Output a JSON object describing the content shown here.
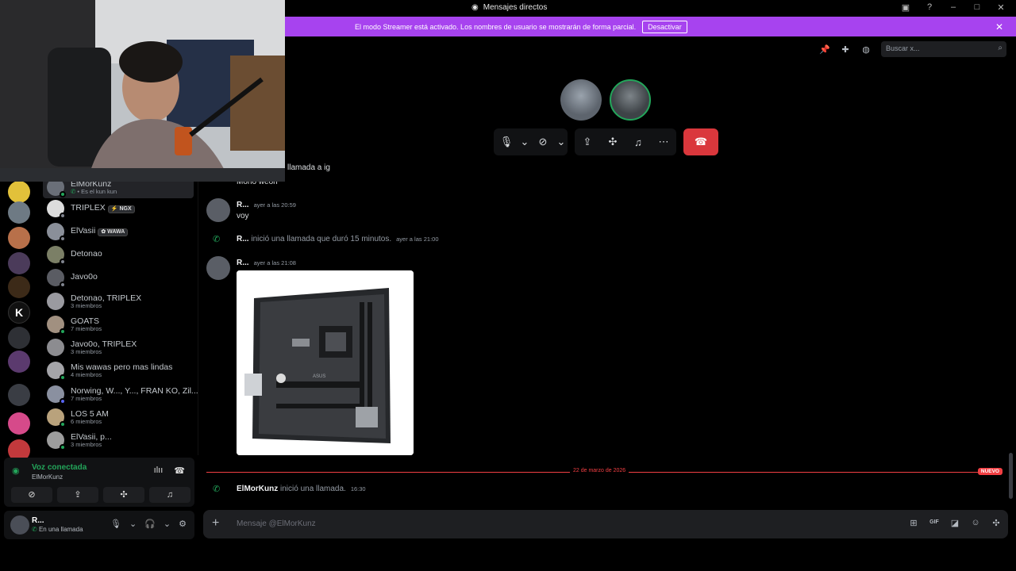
{
  "titlebar": {
    "title": "Mensajes directos"
  },
  "streamer": {
    "message": "El modo Streamer está activado. Los nombres de usuario se mostrarán de forma parcial.",
    "button": "Desactivar"
  },
  "dms": [
    {
      "name": "ElMorKunz",
      "sub": "Es el kun kun",
      "status": "on",
      "active": true
    },
    {
      "name": "TRIPLEX",
      "tag": "NGX",
      "sub": "",
      "status": "off"
    },
    {
      "name": "ElVasii",
      "tag": "WAWA",
      "sub": "",
      "status": "off"
    },
    {
      "name": "Detonao",
      "sub": "",
      "status": "off"
    },
    {
      "name": "Javo0o",
      "sub": "",
      "status": "off"
    },
    {
      "name": "Detonao, TRIPLEX",
      "sub": "3 miembros",
      "status": ""
    },
    {
      "name": "GOATS",
      "sub": "7 miembros",
      "status": "on"
    },
    {
      "name": "Javo0o, TRIPLEX",
      "sub": "3 miembros",
      "status": ""
    },
    {
      "name": "Mis wawas pero mas lindas",
      "sub": "4 miembros",
      "status": "on"
    },
    {
      "name": "Norwing, W..., Y..., FRAN KO, Zil...",
      "sub": "7 miembros",
      "status": "on"
    },
    {
      "name": "LOS 5 AM",
      "sub": "6 miembros",
      "status": "on"
    },
    {
      "name": "ElVasii, p...",
      "sub": "3 miembros",
      "status": "on"
    }
  ],
  "voice": {
    "title": "Voz conectada",
    "channel": "ElMorKunz"
  },
  "user": {
    "name": "R...",
    "status": "En una llamada"
  },
  "search": {
    "placeholder": "Buscar x..."
  },
  "chat": {
    "partial_line_1": "llamada a ig",
    "partial_line_2": "Mono weón",
    "msg1": {
      "author": "R...",
      "time": "ayer a las 20:59",
      "text": "voy"
    },
    "sys1": {
      "author": "R...",
      "text": "inició una llamada que duró 15 minutos.",
      "time": "ayer a las 21:00"
    },
    "msg2": {
      "author": "R...",
      "time": "ayer a las 21:08"
    },
    "divider_date": "22 de marzo de 2026",
    "divider_new": "NUEVO",
    "sys2": {
      "author": "ElMorKunz",
      "text": "inició una llamada.",
      "time": "16:30"
    }
  },
  "composer": {
    "placeholder": "Mensaje @ElMorKunz"
  },
  "colors": {
    "accent_green": "#23a55a",
    "danger": "#da373c",
    "streamer": "#a743ef",
    "new_divider": "#f23f43"
  }
}
